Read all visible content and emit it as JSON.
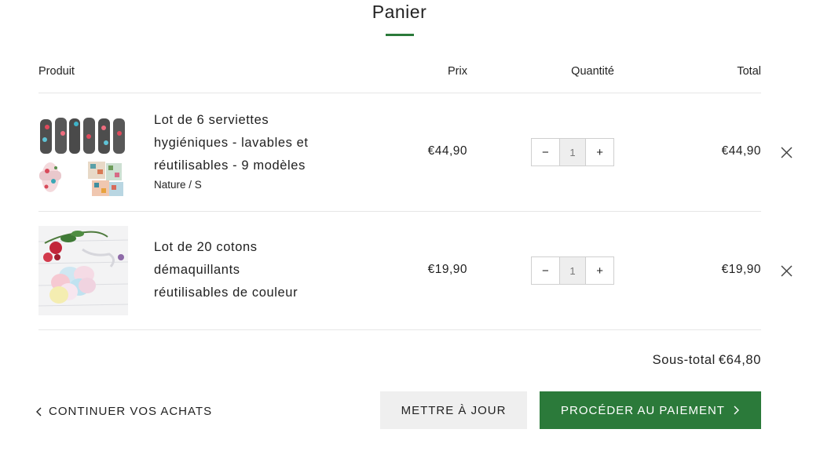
{
  "page": {
    "title": "Panier"
  },
  "table_headers": {
    "product": "Produit",
    "price": "Prix",
    "quantity": "Quantité",
    "total": "Total"
  },
  "items": [
    {
      "name_lines": [
        "Lot de 6 serviettes",
        "hygiéniques - lavables et",
        "réutilisables - 9 modèles"
      ],
      "variant": "Nature / S",
      "price": "€44,90",
      "quantity": "1",
      "minus": "−",
      "plus": "+",
      "total": "€44,90",
      "image": "cloth-pads-thumbnail"
    },
    {
      "name_lines": [
        "Lot de 20 cotons",
        "démaquillants",
        "réutilisables de couleur"
      ],
      "variant": "",
      "price": "€19,90",
      "quantity": "1",
      "minus": "−",
      "plus": "+",
      "total": "€19,90",
      "image": "cotton-rounds-thumbnail"
    }
  ],
  "summary": {
    "subtotal_label": "Sous-total",
    "subtotal_value": "€64,80"
  },
  "actions": {
    "continue_label": "CONTINUER VOS ACHATS",
    "update_label": "METTRE À JOUR",
    "checkout_label": "PROCÉDER AU PAIEMENT"
  },
  "colors": {
    "accent": "#2b7a3a",
    "divider": "#e6e6e6",
    "update_bg": "#efefef",
    "qty_bg": "#eeeeee"
  },
  "icons": {
    "remove": "close-icon",
    "continue": "chevron-left-icon",
    "checkout": "chevron-right-icon"
  }
}
